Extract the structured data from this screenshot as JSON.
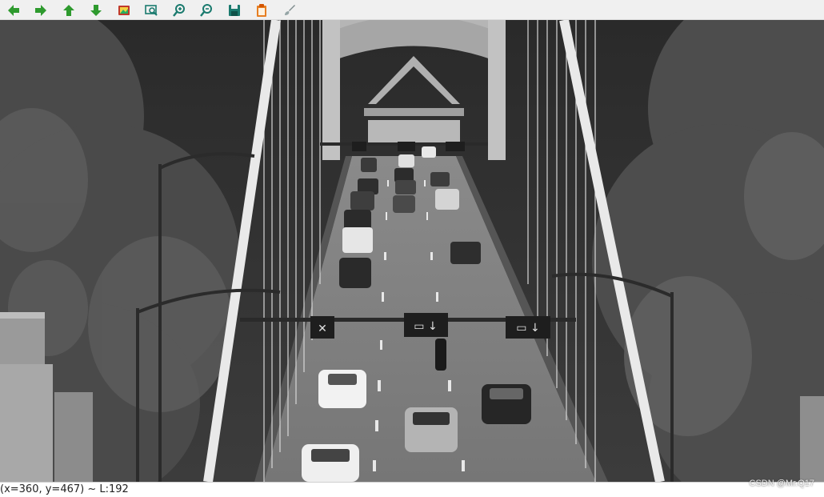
{
  "toolbar": {
    "buttons": [
      {
        "icon": "arrow-left-icon",
        "color": "#2e9a2e"
      },
      {
        "icon": "arrow-right-icon",
        "color": "#2e9a2e"
      },
      {
        "icon": "arrow-up-icon",
        "color": "#2e9a2e"
      },
      {
        "icon": "arrow-down-icon",
        "color": "#2e9a2e"
      },
      {
        "icon": "save-image-icon",
        "color": "#c0392b"
      },
      {
        "icon": "zoom-area-icon",
        "color": "#1a7a6e"
      },
      {
        "icon": "zoom-in-icon",
        "color": "#1a7a6e"
      },
      {
        "icon": "zoom-out-icon",
        "color": "#1a7a6e"
      },
      {
        "icon": "save-icon",
        "color": "#1a7a6e"
      },
      {
        "icon": "copy-clipboard-icon",
        "color": "#e67e22"
      },
      {
        "icon": "properties-brush-icon",
        "color": "#7f8c8d"
      }
    ]
  },
  "image": {
    "description_icon": "grayscale-bridge-photo"
  },
  "status": {
    "text": "(x=360, y=467) ~ L:192"
  },
  "watermark": {
    "text": "CSDN @Mr.Q17"
  }
}
